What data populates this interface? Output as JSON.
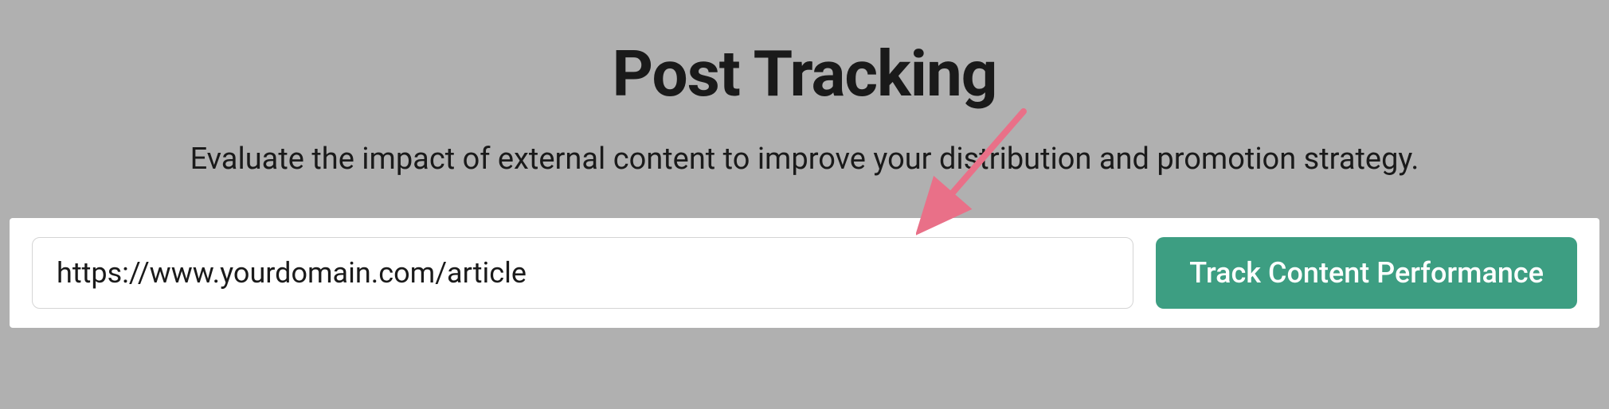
{
  "header": {
    "title": "Post Tracking",
    "subtitle": "Evaluate the impact of external content to improve your distribution and promotion strategy."
  },
  "form": {
    "url_value": "https://www.yourdomain.com/article",
    "button_label": "Track Content Performance"
  }
}
